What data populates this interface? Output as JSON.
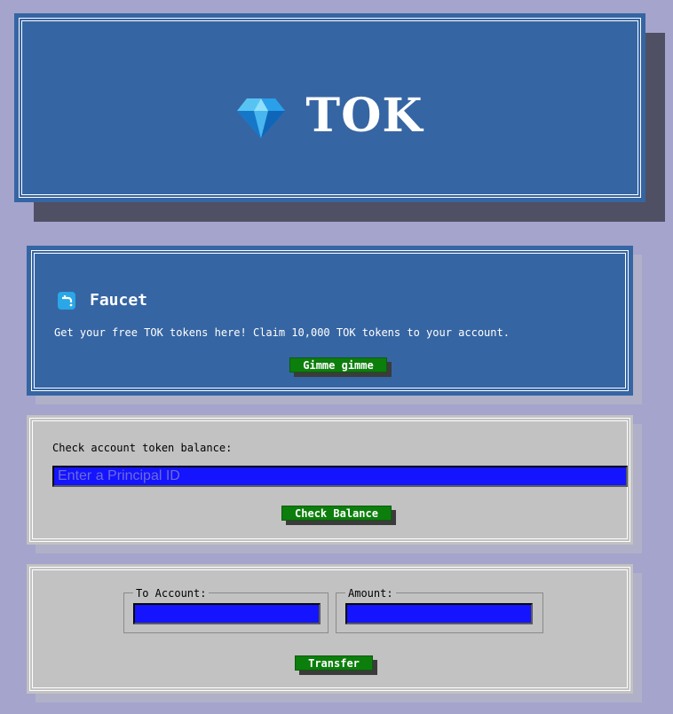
{
  "header": {
    "logo_icon": "diamond-gem-icon",
    "title": "TOK"
  },
  "faucet": {
    "icon": "faucet-icon",
    "title": "Faucet",
    "description": "Get your free TOK tokens here! Claim 10,000 TOK tokens to your account.",
    "button_label": "Gimme gimme"
  },
  "balance": {
    "label": "Check account token balance:",
    "input_placeholder": "Enter a Principal ID",
    "input_value": "",
    "button_label": "Check Balance"
  },
  "transfer": {
    "to_account_label": "To Account:",
    "to_account_value": "",
    "amount_label": "Amount:",
    "amount_value": "",
    "button_label": "Transfer"
  },
  "colors": {
    "page_background": "#a4a4cd",
    "panel_blue": "#3665a3",
    "panel_gray": "#c2c2c2",
    "input_blue": "#1414ff",
    "button_green": "#0c7e0c"
  }
}
